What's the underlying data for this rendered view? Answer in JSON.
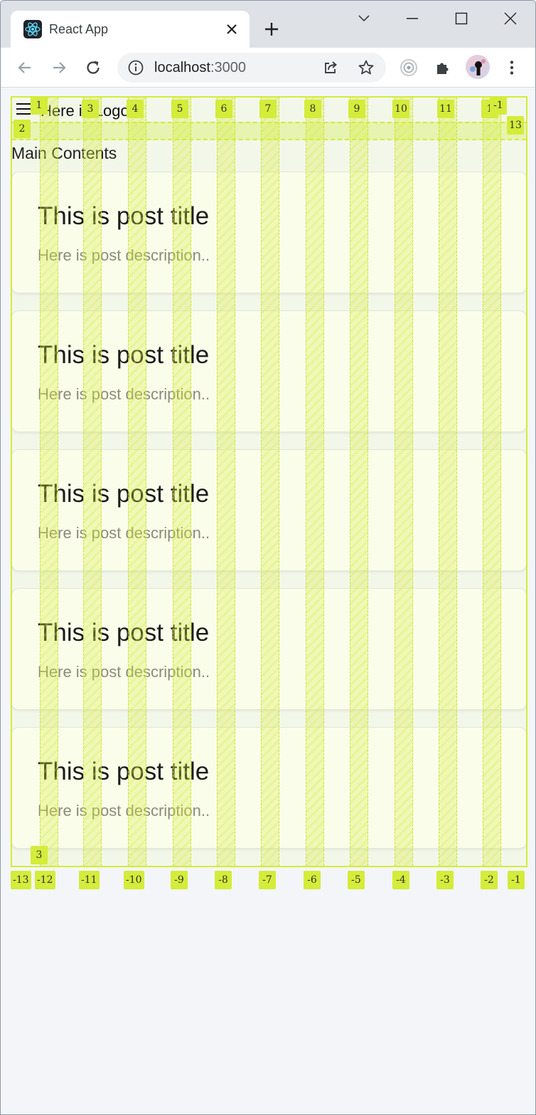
{
  "browser": {
    "tab": {
      "title": "React App",
      "favicon": "react-logo-icon",
      "close_icon": "close-icon"
    },
    "new_tab_icon": "plus-icon",
    "window_controls": [
      "chevron-down-icon",
      "minimize-icon",
      "maximize-icon",
      "close-icon"
    ],
    "toolbar": {
      "back_icon": "arrow-left-icon",
      "forward_icon": "arrow-right-icon",
      "reload_icon": "reload-icon",
      "omnibox": {
        "info_icon": "info-icon",
        "host": "localhost",
        "port": ":3000",
        "share_icon": "share-icon",
        "bookmark_icon": "star-icon"
      },
      "extensions": [
        "record-icon",
        "puzzle-icon"
      ],
      "avatar": "profile-avatar",
      "menu_icon": "more-vertical-icon"
    }
  },
  "app": {
    "header": {
      "menu_icon": "hamburger-icon",
      "logo_text": "Here is Logo"
    },
    "main_title": "Main Contents",
    "posts": [
      {
        "title": "This is post title",
        "description": "Here is post description.."
      },
      {
        "title": "This is post title",
        "description": "Here is post description.."
      },
      {
        "title": "This is post title",
        "description": "Here is post description.."
      },
      {
        "title": "This is post title",
        "description": "Here is post description.."
      },
      {
        "title": "This is post title",
        "description": "Here is post description.."
      }
    ]
  },
  "grid_overlay": {
    "color": "#d4ec3a",
    "top_labels": [
      "1",
      "3",
      "4",
      "5",
      "6",
      "7",
      "8",
      "9",
      "10",
      "11",
      "1",
      "-1"
    ],
    "row_labels": [
      "2",
      "13",
      "3"
    ],
    "bottom_labels": [
      "-13",
      "-12",
      "-11",
      "-10",
      "-9",
      "-8",
      "-7",
      "-6",
      "-5",
      "-4",
      "-3",
      "-2",
      "-1"
    ]
  }
}
